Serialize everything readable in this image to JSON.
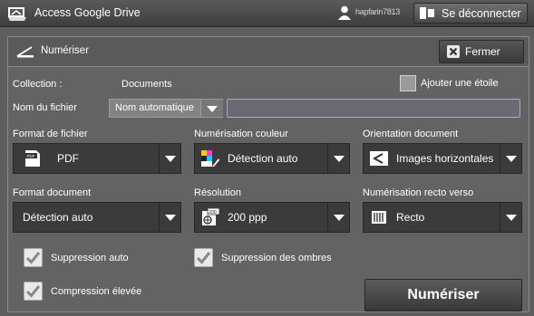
{
  "topbar": {
    "app_icon": "drive-tray-icon",
    "title": "Access Google Drive",
    "user_icon": "user-icon",
    "user_name": "hapfarin7813",
    "logout_icon": "logout-icon",
    "logout_label": "Se déconnecter"
  },
  "panel": {
    "scan_icon": "scanner-icon",
    "title": "Numériser",
    "close_icon": "close-icon",
    "close_label": "Fermer"
  },
  "collection": {
    "label": "Collection :",
    "value": "Documents"
  },
  "favorite": {
    "label": "Ajouter une étoile",
    "checked": false
  },
  "filename": {
    "label": "Nom du fichier",
    "select_value": "Nom automatique",
    "input_value": ""
  },
  "options": {
    "file_format": {
      "label": "Format de fichier",
      "value": "PDF",
      "icon": "pdf-file-icon"
    },
    "color_scan": {
      "label": "Numérisation couleur",
      "value": "Détection auto",
      "icon": "color-detect-icon"
    },
    "orientation": {
      "label": "Orientation document",
      "value": "Images horizontales",
      "icon": "landscape-orientation-icon"
    },
    "doc_format": {
      "label": "Format document",
      "value": "Détection auto"
    },
    "resolution": {
      "label": "Résolution",
      "value": "200 ppp",
      "icon": "resolution-200-icon"
    },
    "duplex": {
      "label": "Numérisation recto verso",
      "value": "Recto",
      "icon": "one-sided-icon"
    }
  },
  "checkboxes": {
    "auto_suppress": {
      "label": "Suppression auto",
      "checked": true
    },
    "shadow_suppress": {
      "label": "Suppression des ombres",
      "checked": true
    },
    "high_compression": {
      "label": "Compression élevée",
      "checked": true
    }
  },
  "scan_button": {
    "label": "Numériser"
  },
  "colors": {
    "background": "#5e5e5e",
    "panel": "#636363",
    "dropdown": "#3b3b3b",
    "input_border": "#a9a9c5"
  }
}
